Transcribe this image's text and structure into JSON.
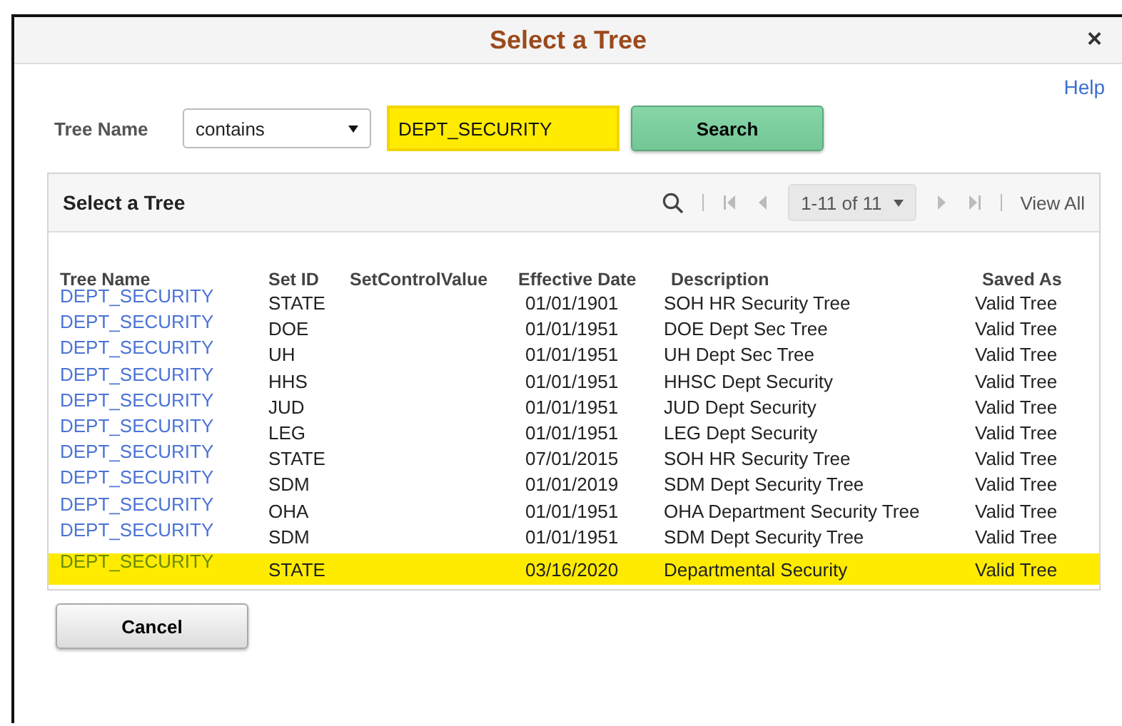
{
  "dialog": {
    "title": "Select a Tree",
    "close": "×",
    "help_link": "Help"
  },
  "search": {
    "label": "Tree Name",
    "operator": "contains",
    "value": "DEPT_SECURITY",
    "value_highlighted": true,
    "button": "Search"
  },
  "grid": {
    "title": "Select a Tree",
    "pager": {
      "range": "1-11 of 11",
      "view_all": "View All"
    },
    "columns": [
      "Tree Name",
      "Set ID",
      "SetControlValue",
      "Effective Date",
      "Description",
      "Saved As"
    ],
    "rows": [
      {
        "tree_name": "DEPT_SECURITY",
        "set_id": "STATE",
        "effective_date": "01/01/1901",
        "description": "SOH HR Security Tree",
        "saved_as": "Valid Tree",
        "highlighted": false
      },
      {
        "tree_name": "DEPT_SECURITY",
        "set_id": "DOE",
        "effective_date": "01/01/1951",
        "description": "DOE Dept Sec Tree",
        "saved_as": "Valid Tree",
        "highlighted": false
      },
      {
        "tree_name": "DEPT_SECURITY",
        "set_id": "UH",
        "effective_date": "01/01/1951",
        "description": "UH Dept Sec Tree",
        "saved_as": "Valid Tree",
        "highlighted": false
      },
      {
        "tree_name": "DEPT_SECURITY",
        "set_id": "HHS",
        "effective_date": "01/01/1951",
        "description": "HHSC Dept Security",
        "saved_as": "Valid Tree",
        "highlighted": false
      },
      {
        "tree_name": "DEPT_SECURITY",
        "set_id": "JUD",
        "effective_date": "01/01/1951",
        "description": "JUD Dept Security",
        "saved_as": "Valid Tree",
        "highlighted": false
      },
      {
        "tree_name": "DEPT_SECURITY",
        "set_id": "LEG",
        "effective_date": "01/01/1951",
        "description": "LEG Dept Security",
        "saved_as": "Valid Tree",
        "highlighted": false
      },
      {
        "tree_name": "DEPT_SECURITY",
        "set_id": "STATE",
        "effective_date": "07/01/2015",
        "description": "SOH HR Security Tree",
        "saved_as": "Valid Tree",
        "highlighted": false
      },
      {
        "tree_name": "DEPT_SECURITY",
        "set_id": "SDM",
        "effective_date": "01/01/2019",
        "description": "SDM Dept Security Tree",
        "saved_as": "Valid Tree",
        "highlighted": false
      },
      {
        "tree_name": "DEPT_SECURITY",
        "set_id": "OHA",
        "effective_date": "01/01/1951",
        "description": "OHA Department Security Tree",
        "saved_as": "Valid Tree",
        "highlighted": false
      },
      {
        "tree_name": "DEPT_SECURITY",
        "set_id": "SDM",
        "effective_date": "01/01/1951",
        "description": "SDM Dept Security Tree",
        "saved_as": "Valid Tree",
        "highlighted": false
      },
      {
        "tree_name": "DEPT_SECURITY",
        "set_id": "STATE",
        "effective_date": "03/16/2020",
        "description": "Departmental Security",
        "saved_as": "Valid Tree",
        "highlighted": true
      }
    ]
  },
  "cancel_button": "Cancel"
}
